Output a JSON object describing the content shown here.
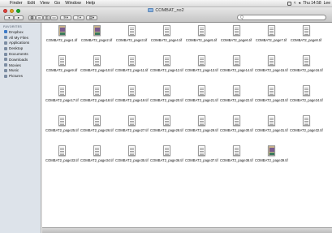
{
  "menubar": {
    "apple": "",
    "items": [
      "Finder",
      "Edit",
      "View",
      "Go",
      "Window",
      "Help"
    ],
    "clock": "Thu 14:58",
    "user": "Lee"
  },
  "window": {
    "title": "COMBAT_no2"
  },
  "search": {
    "placeholder": "Q"
  },
  "sidebar": {
    "heading": "FAVORITES",
    "items": [
      {
        "label": "Dropbox",
        "icon": "dropbox-icon",
        "color": "#3d7bc8"
      },
      {
        "label": "All My Files",
        "icon": "all-files-icon",
        "color": "#6f8fb3"
      },
      {
        "label": "Applications",
        "icon": "applications-icon",
        "color": "#7c8da3"
      },
      {
        "label": "Desktop",
        "icon": "desktop-icon",
        "color": "#7c8da3"
      },
      {
        "label": "Documents",
        "icon": "documents-icon",
        "color": "#7c8da3"
      },
      {
        "label": "Downloads",
        "icon": "downloads-icon",
        "color": "#7c8da3"
      },
      {
        "label": "Movies",
        "icon": "movies-icon",
        "color": "#7c8da3"
      },
      {
        "label": "Music",
        "icon": "music-icon",
        "color": "#7c8da3"
      },
      {
        "label": "Pictures",
        "icon": "pictures-icon",
        "color": "#7c8da3"
      }
    ]
  },
  "files": [
    {
      "name": "COMBAT2_page1.tif",
      "color": true
    },
    {
      "name": "COMBAT2_page2.tif",
      "color": true
    },
    {
      "name": "COMBAT2_page3.tif"
    },
    {
      "name": "COMBAT2_page4.tif"
    },
    {
      "name": "COMBAT2_page5.tif"
    },
    {
      "name": "COMBAT2_page6.tif"
    },
    {
      "name": "COMBAT2_page7.tif"
    },
    {
      "name": "COMBAT2_page8.tif"
    },
    {
      "name": "COMBAT2_page9.tif"
    },
    {
      "name": "COMBAT2_page10.tif"
    },
    {
      "name": "COMBAT2_page11.tif"
    },
    {
      "name": "COMBAT2_page12.tif"
    },
    {
      "name": "COMBAT2_page13.tif"
    },
    {
      "name": "COMBAT2_page14.tif"
    },
    {
      "name": "COMBAT2_page15.tif"
    },
    {
      "name": "COMBAT2_page16.tif"
    },
    {
      "name": "COMBAT2_page17.tif"
    },
    {
      "name": "COMBAT2_page18.tif"
    },
    {
      "name": "COMBAT2_page19.tif"
    },
    {
      "name": "COMBAT2_page20.tif"
    },
    {
      "name": "COMBAT2_page21.tif"
    },
    {
      "name": "COMBAT2_page22.tif"
    },
    {
      "name": "COMBAT2_page23.tif"
    },
    {
      "name": "COMBAT2_page24.tif"
    },
    {
      "name": "COMBAT2_page25.tif"
    },
    {
      "name": "COMBAT2_page26.tif"
    },
    {
      "name": "COMBAT2_page27.tif"
    },
    {
      "name": "COMBAT2_page28.tif"
    },
    {
      "name": "COMBAT2_page29.tif"
    },
    {
      "name": "COMBAT2_page30.tif"
    },
    {
      "name": "COMBAT2_page31.tif"
    },
    {
      "name": "COMBAT2_page32.tif"
    },
    {
      "name": "COMBAT2_page33.tif"
    },
    {
      "name": "COMBAT2_page34.tif"
    },
    {
      "name": "COMBAT2_page35.tif"
    },
    {
      "name": "COMBAT2_page36.tif"
    },
    {
      "name": "COMBAT2_page37.tif"
    },
    {
      "name": "COMBAT2_page38.tif"
    },
    {
      "name": "COMBAT2_page39.tif",
      "color": true
    }
  ]
}
